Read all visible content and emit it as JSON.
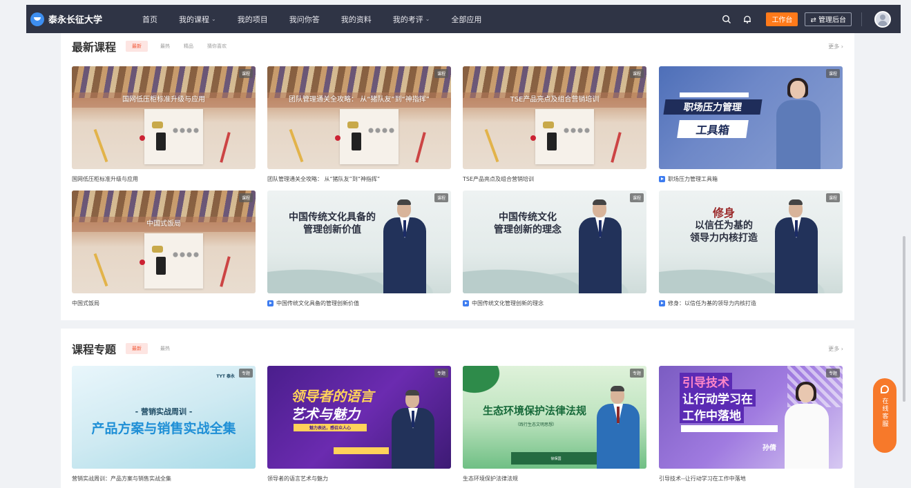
{
  "topbar": {
    "brand": "泰永长征大学",
    "nav": [
      {
        "label": "首页",
        "dropdown": false
      },
      {
        "label": "我的课程",
        "dropdown": true
      },
      {
        "label": "我的项目",
        "dropdown": false
      },
      {
        "label": "我问你答",
        "dropdown": false
      },
      {
        "label": "我的资料",
        "dropdown": false
      },
      {
        "label": "我的考评",
        "dropdown": true
      },
      {
        "label": "全部应用",
        "dropdown": false
      }
    ],
    "work_label": "工作台",
    "admin_label": "⇄ 管理后台",
    "icons": [
      "search-icon",
      "bell-icon",
      "avatar"
    ]
  },
  "latest": {
    "title": "最新课程",
    "tags": [
      "最新",
      "最热",
      "精品",
      "猜你喜欢"
    ],
    "more": "更多 ›",
    "cards": [
      {
        "title": "国网低压柜标准升级与应用",
        "thumb_text": "国网低压柜标准升级与应用",
        "badge": "课程",
        "video": false
      },
      {
        "title": "团队管理通关全攻略： 从“猪队友”到“神指挥”",
        "thumb_text": "团队管理通关全攻略： 从“猪队友”到“神指挥”",
        "badge": "课程",
        "video": false
      },
      {
        "title": "TSE产品亮点及组合营销培训",
        "thumb_text": "TSE产品亮点及组合营销培训",
        "badge": "课程",
        "video": false
      },
      {
        "title": "职场压力管理工具箱",
        "thumb_lines": [
          "职场压力管理",
          "工具箱"
        ],
        "badge": "课程",
        "video": true
      },
      {
        "title": "中国式饭局",
        "thumb_text": "中国式饭局",
        "badge": "课程",
        "video": false
      },
      {
        "title": "中国传统文化具备的管理创新价值",
        "thumb_lines": [
          "中国传统文化具备的",
          "管理创新价值"
        ],
        "badge": "课程",
        "video": true
      },
      {
        "title": "中国传统文化管理创新的理念",
        "thumb_lines": [
          "中国传统文化",
          "管理创新的理念"
        ],
        "badge": "课程",
        "video": true
      },
      {
        "title": "修身：以信任为基的领导力内核打造",
        "thumb_lines": [
          "修身",
          "以信任为基的",
          "领导力内核打造"
        ],
        "badge": "课程",
        "video": true
      }
    ]
  },
  "topics": {
    "title": "课程专题",
    "tags": [
      "最新",
      "最热"
    ],
    "more": "更多 ›",
    "cards": [
      {
        "title": "营销实战周训：产品方案与销售实战全集",
        "thumb_lines": [
          "- 营销实战周训 -",
          "产品方案与销售实战全集"
        ],
        "logo": "TYT 泰永",
        "badge": "专题"
      },
      {
        "title": "领导者的语言艺术与魅力",
        "thumb_lines": [
          "领导者的语言",
          "艺术与魅力",
          "魅力表达，感召众人心"
        ],
        "badge": "专题"
      },
      {
        "title": "生态环境保护法律法规",
        "thumb_lines": [
          "生态环境保护法律法规",
          "（践行生态文明思想）",
          "徐保国"
        ],
        "badge": "专题"
      },
      {
        "title": "引导技术--让行动学习在工作中落地",
        "thumb_lines": [
          "引导技术",
          "让行动学习在",
          "工作中落地",
          "孙倩"
        ],
        "badge": "专题"
      }
    ]
  },
  "support": {
    "label": "在线客服"
  },
  "colors": {
    "topbar": "#2f3445",
    "accent": "#ff7a1a",
    "tag_active": "#f25a3a",
    "support": "#f7792a"
  }
}
